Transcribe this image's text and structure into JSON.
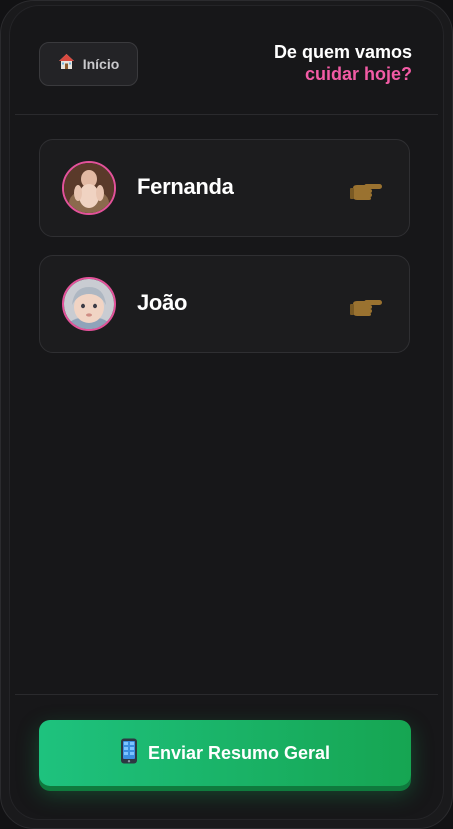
{
  "header": {
    "home_label": "Início",
    "title_line1": "De quem vamos",
    "title_line2": "cuidar hoje?"
  },
  "profiles": [
    {
      "name": "Fernanda",
      "avatar": "baby-photo-fernanda",
      "action_icon": "pointing-hand-icon"
    },
    {
      "name": "João",
      "avatar": "baby-photo-joao",
      "action_icon": "pointing-hand-icon"
    }
  ],
  "footer": {
    "send_label": "Enviar Resumo Geral",
    "send_icon": "mobile-phone-icon"
  },
  "colors": {
    "accent_pink": "#f25ba5",
    "button_green": "#19b466",
    "background": "#171719"
  }
}
